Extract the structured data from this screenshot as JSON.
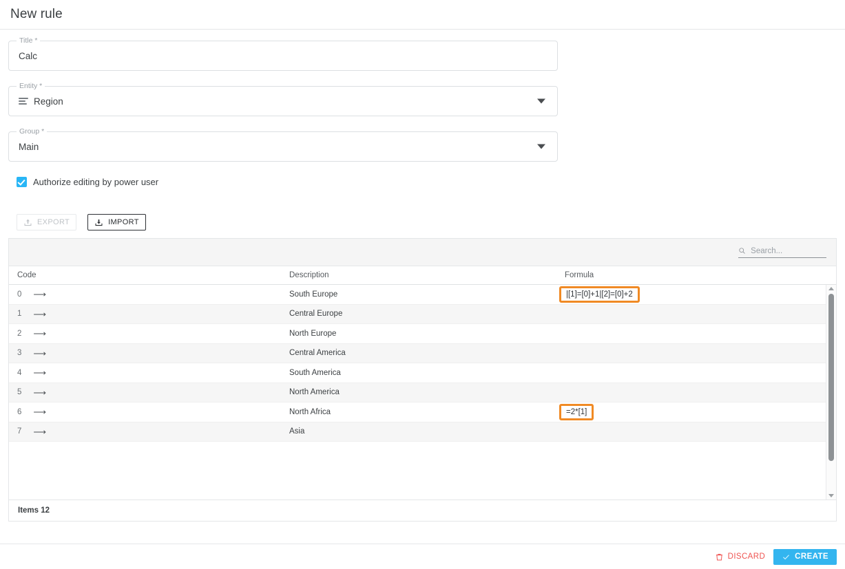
{
  "header": {
    "title": "New rule"
  },
  "form": {
    "fields": [
      {
        "label": "Title *",
        "value": "Calc",
        "icon": null,
        "has_caret": false
      },
      {
        "label": "Entity *",
        "value": "Region",
        "icon": "list-lines-icon",
        "has_caret": true
      },
      {
        "label": "Group *",
        "value": "Main",
        "icon": null,
        "has_caret": true
      }
    ],
    "checkbox": {
      "label": "Authorize editing by power user",
      "checked": true
    }
  },
  "toolbar": {
    "export_label": "EXPORT",
    "export_icon": "upload-icon",
    "export_disabled": true,
    "import_label": "IMPORT",
    "import_icon": "download-icon",
    "import_disabled": false
  },
  "table": {
    "search": {
      "placeholder": "Search...",
      "value": "",
      "icon": "search-icon"
    },
    "columns": [
      "Code",
      "Description",
      "Formula"
    ],
    "rows": [
      {
        "code": "0",
        "description": "South Europe",
        "formula": "|[1]=[0]+1|[2]=[0]+2",
        "highlighted": true
      },
      {
        "code": "1",
        "description": "Central Europe",
        "formula": "",
        "highlighted": false
      },
      {
        "code": "2",
        "description": "North Europe",
        "formula": "",
        "highlighted": false
      },
      {
        "code": "3",
        "description": "Central America",
        "formula": "",
        "highlighted": false
      },
      {
        "code": "4",
        "description": "South America",
        "formula": "",
        "highlighted": false
      },
      {
        "code": "5",
        "description": "North America",
        "formula": "",
        "highlighted": false
      },
      {
        "code": "6",
        "description": "North Africa",
        "formula": "=2*[1]",
        "highlighted": true
      },
      {
        "code": "7",
        "description": "Asia",
        "formula": "",
        "highlighted": false
      }
    ],
    "footer": "Items 12"
  },
  "bottom_bar": {
    "discard_label": "DISCARD",
    "discard_icon": "trash-icon",
    "create_label": "CREATE",
    "create_icon": "check-icon"
  },
  "colors": {
    "accent": "#33b5ef",
    "danger": "#ef5350",
    "highlight": "#f08a24",
    "checkbox": "#29b6f6"
  }
}
